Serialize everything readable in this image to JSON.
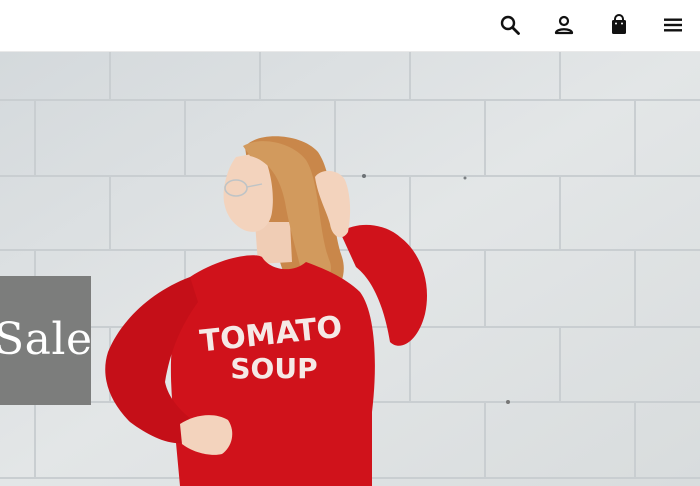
{
  "header": {
    "icons": {
      "search": "search-icon",
      "account": "account-icon",
      "bag": "shopping-bag-icon",
      "menu": "hamburger-menu-icon"
    }
  },
  "hero": {
    "banner_text": "Sale",
    "sweatshirt_text_line1": "TOMATO",
    "sweatshirt_text_line2": "SOUP",
    "colors": {
      "wall": "#dfe2e4",
      "sweatshirt": "#d0121b",
      "banner_bg": "#7c7d7c",
      "hair": "#c9874a"
    }
  }
}
